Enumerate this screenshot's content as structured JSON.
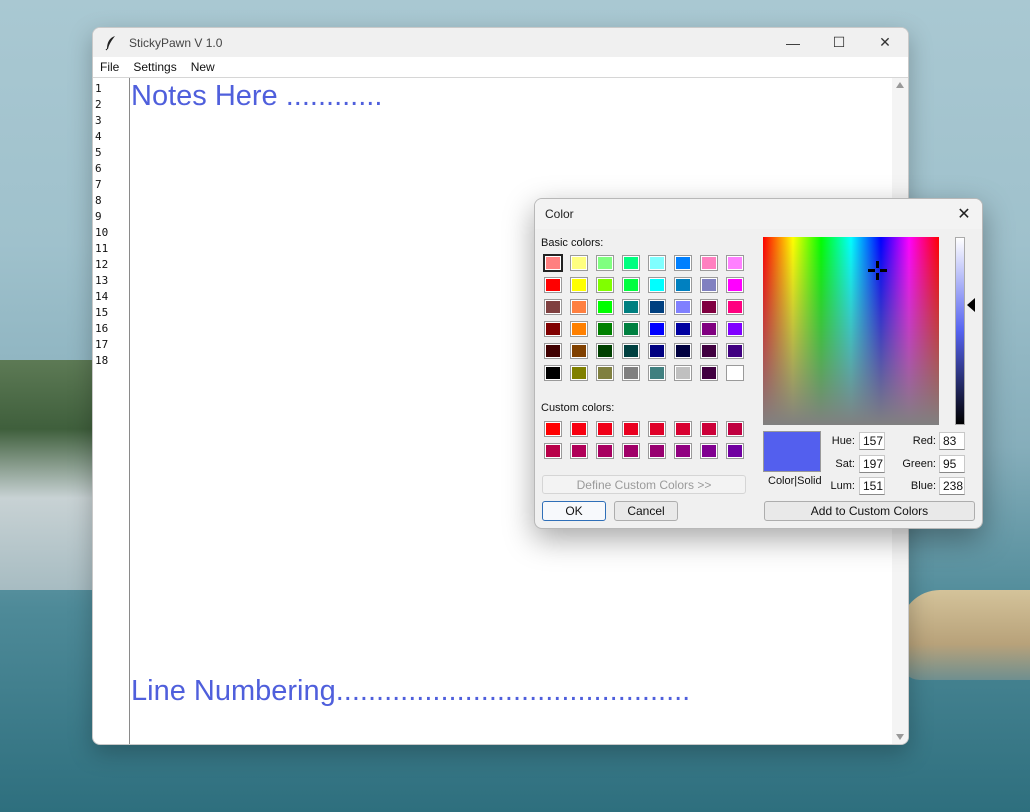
{
  "window": {
    "title": "StickyPawn V 1.0",
    "controls": {
      "minimize": "—",
      "maximize": "☐",
      "close": "✕"
    }
  },
  "menu": [
    "File",
    "Settings",
    "New"
  ],
  "editor": {
    "line_numbers": [
      "1",
      "2",
      "3",
      "4",
      "5",
      "6",
      "7",
      "8",
      "9",
      "10",
      "11",
      "12",
      "13",
      "14",
      "15",
      "16",
      "17",
      "18"
    ],
    "note_top": "Notes Here ............",
    "note_bottom": "Line Numbering............................................"
  },
  "color_dialog": {
    "title": "Color",
    "close": "✕",
    "basic_colors_label": "Basic colors:",
    "custom_colors_label": "Custom colors:",
    "basic_colors": [
      [
        "#ff8080",
        "#ffff80",
        "#80ff80",
        "#00ff80",
        "#80ffff",
        "#0080ff",
        "#ff80c0",
        "#ff80ff"
      ],
      [
        "#ff0000",
        "#ffff00",
        "#80ff00",
        "#00ff40",
        "#00ffff",
        "#0080c0",
        "#8080c0",
        "#ff00ff"
      ],
      [
        "#804040",
        "#ff8040",
        "#00ff00",
        "#008080",
        "#004080",
        "#8080ff",
        "#800040",
        "#ff0080"
      ],
      [
        "#800000",
        "#ff8000",
        "#008000",
        "#008040",
        "#0000ff",
        "#0000a0",
        "#800080",
        "#8000ff"
      ],
      [
        "#400000",
        "#804000",
        "#004000",
        "#004040",
        "#000080",
        "#000040",
        "#400040",
        "#400080"
      ],
      [
        "#000000",
        "#808000",
        "#808040",
        "#808080",
        "#408080",
        "#c0c0c0",
        "#400040",
        "#ffffff"
      ]
    ],
    "custom_colors": [
      [
        "#ff0000",
        "#f80010",
        "#f00018",
        "#ea0020",
        "#e00028",
        "#d80030",
        "#cc0038",
        "#c00040"
      ],
      [
        "#b80048",
        "#b00058",
        "#a80060",
        "#a00068",
        "#980070",
        "#900080",
        "#800090",
        "#7000a0"
      ]
    ],
    "define_button": "Define Custom Colors >>",
    "ok_button": "OK",
    "cancel_button": "Cancel",
    "preview_label": "Color|Solid",
    "preview_color": "#535fee",
    "hue_label": "Hue:",
    "hue": "157",
    "sat_label": "Sat:",
    "sat": "197",
    "lum_label": "Lum:",
    "lum": "151",
    "red_label": "Red:",
    "red": "83",
    "green_label": "Green:",
    "green": "95",
    "blue_label": "Blue:",
    "blue": "238",
    "add_button": "Add to Custom Colors"
  }
}
